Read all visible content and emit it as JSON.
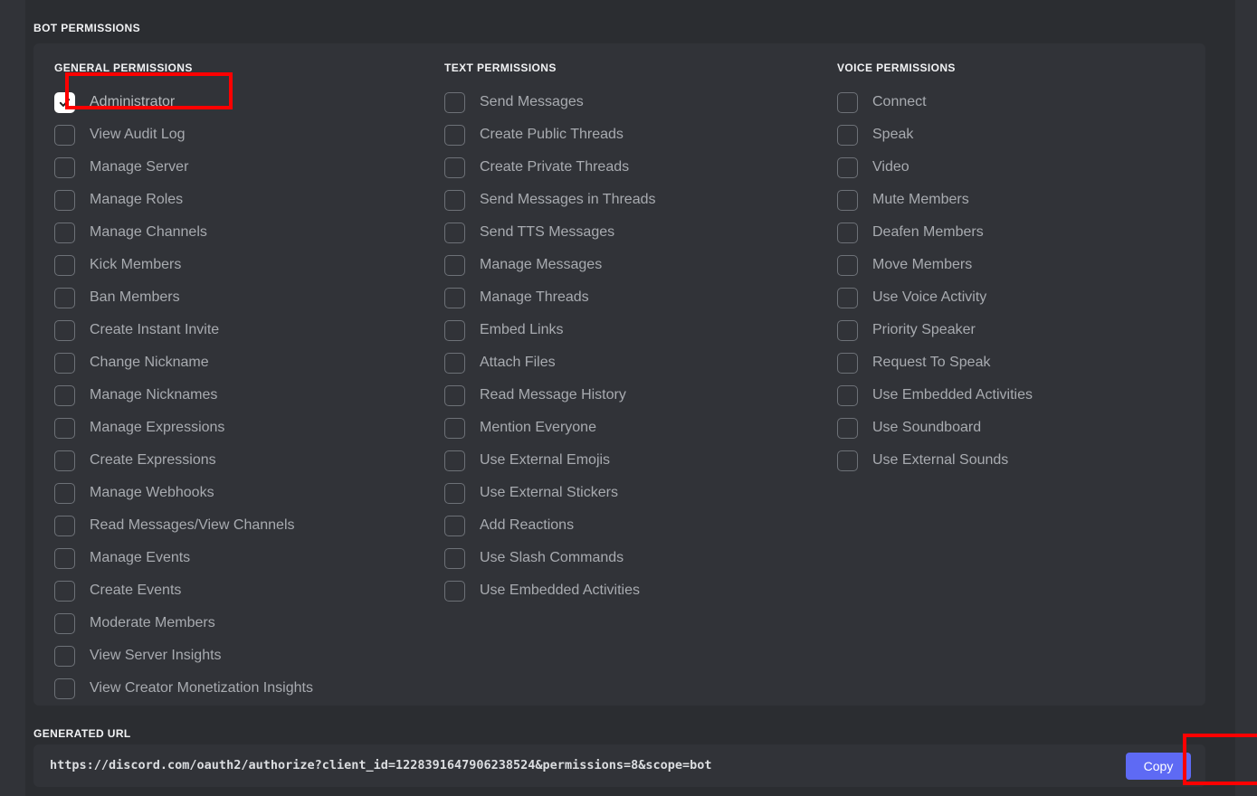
{
  "page": {
    "bot_permissions_label": "BOT PERMISSIONS",
    "generated_url_label": "GENERATED URL"
  },
  "colors": {
    "page_background": "#2b2d31",
    "card_background": "#313338",
    "label_text": "#f2f3f5",
    "permission_text": "#a8abb0",
    "checkbox_border": "#6d7177",
    "checkbox_checked_fill": "#ffffff",
    "copy_button": "#5e6af4",
    "annotation_highlight": "#ff0000"
  },
  "columns": [
    {
      "id": "general",
      "header": "GENERAL PERMISSIONS",
      "permissions": [
        {
          "label": "Administrator",
          "checked": true
        },
        {
          "label": "View Audit Log",
          "checked": false
        },
        {
          "label": "Manage Server",
          "checked": false
        },
        {
          "label": "Manage Roles",
          "checked": false
        },
        {
          "label": "Manage Channels",
          "checked": false
        },
        {
          "label": "Kick Members",
          "checked": false
        },
        {
          "label": "Ban Members",
          "checked": false
        },
        {
          "label": "Create Instant Invite",
          "checked": false
        },
        {
          "label": "Change Nickname",
          "checked": false
        },
        {
          "label": "Manage Nicknames",
          "checked": false
        },
        {
          "label": "Manage Expressions",
          "checked": false
        },
        {
          "label": "Create Expressions",
          "checked": false
        },
        {
          "label": "Manage Webhooks",
          "checked": false
        },
        {
          "label": "Read Messages/View Channels",
          "checked": false
        },
        {
          "label": "Manage Events",
          "checked": false
        },
        {
          "label": "Create Events",
          "checked": false
        },
        {
          "label": "Moderate Members",
          "checked": false
        },
        {
          "label": "View Server Insights",
          "checked": false
        },
        {
          "label": "View Creator Monetization Insights",
          "checked": false
        }
      ]
    },
    {
      "id": "text",
      "header": "TEXT PERMISSIONS",
      "permissions": [
        {
          "label": "Send Messages",
          "checked": false
        },
        {
          "label": "Create Public Threads",
          "checked": false
        },
        {
          "label": "Create Private Threads",
          "checked": false
        },
        {
          "label": "Send Messages in Threads",
          "checked": false
        },
        {
          "label": "Send TTS Messages",
          "checked": false
        },
        {
          "label": "Manage Messages",
          "checked": false
        },
        {
          "label": "Manage Threads",
          "checked": false
        },
        {
          "label": "Embed Links",
          "checked": false
        },
        {
          "label": "Attach Files",
          "checked": false
        },
        {
          "label": "Read Message History",
          "checked": false
        },
        {
          "label": "Mention Everyone",
          "checked": false
        },
        {
          "label": "Use External Emojis",
          "checked": false
        },
        {
          "label": "Use External Stickers",
          "checked": false
        },
        {
          "label": "Add Reactions",
          "checked": false
        },
        {
          "label": "Use Slash Commands",
          "checked": false
        },
        {
          "label": "Use Embedded Activities",
          "checked": false
        }
      ]
    },
    {
      "id": "voice",
      "header": "VOICE PERMISSIONS",
      "permissions": [
        {
          "label": "Connect",
          "checked": false
        },
        {
          "label": "Speak",
          "checked": false
        },
        {
          "label": "Video",
          "checked": false
        },
        {
          "label": "Mute Members",
          "checked": false
        },
        {
          "label": "Deafen Members",
          "checked": false
        },
        {
          "label": "Move Members",
          "checked": false
        },
        {
          "label": "Use Voice Activity",
          "checked": false
        },
        {
          "label": "Priority Speaker",
          "checked": false
        },
        {
          "label": "Request To Speak",
          "checked": false
        },
        {
          "label": "Use Embedded Activities",
          "checked": false
        },
        {
          "label": "Use Soundboard",
          "checked": false
        },
        {
          "label": "Use External Sounds",
          "checked": false
        }
      ]
    }
  ],
  "generated_url": {
    "value": "https://discord.com/oauth2/authorize?client_id=1228391647906238524&permissions=8&scope=bot",
    "copy_label": "Copy"
  },
  "annotations": [
    {
      "target": "administrator-permission-row",
      "shape": "rectangle",
      "color": "#ff0000"
    },
    {
      "target": "copy-button",
      "shape": "rectangle",
      "color": "#ff0000"
    }
  ]
}
